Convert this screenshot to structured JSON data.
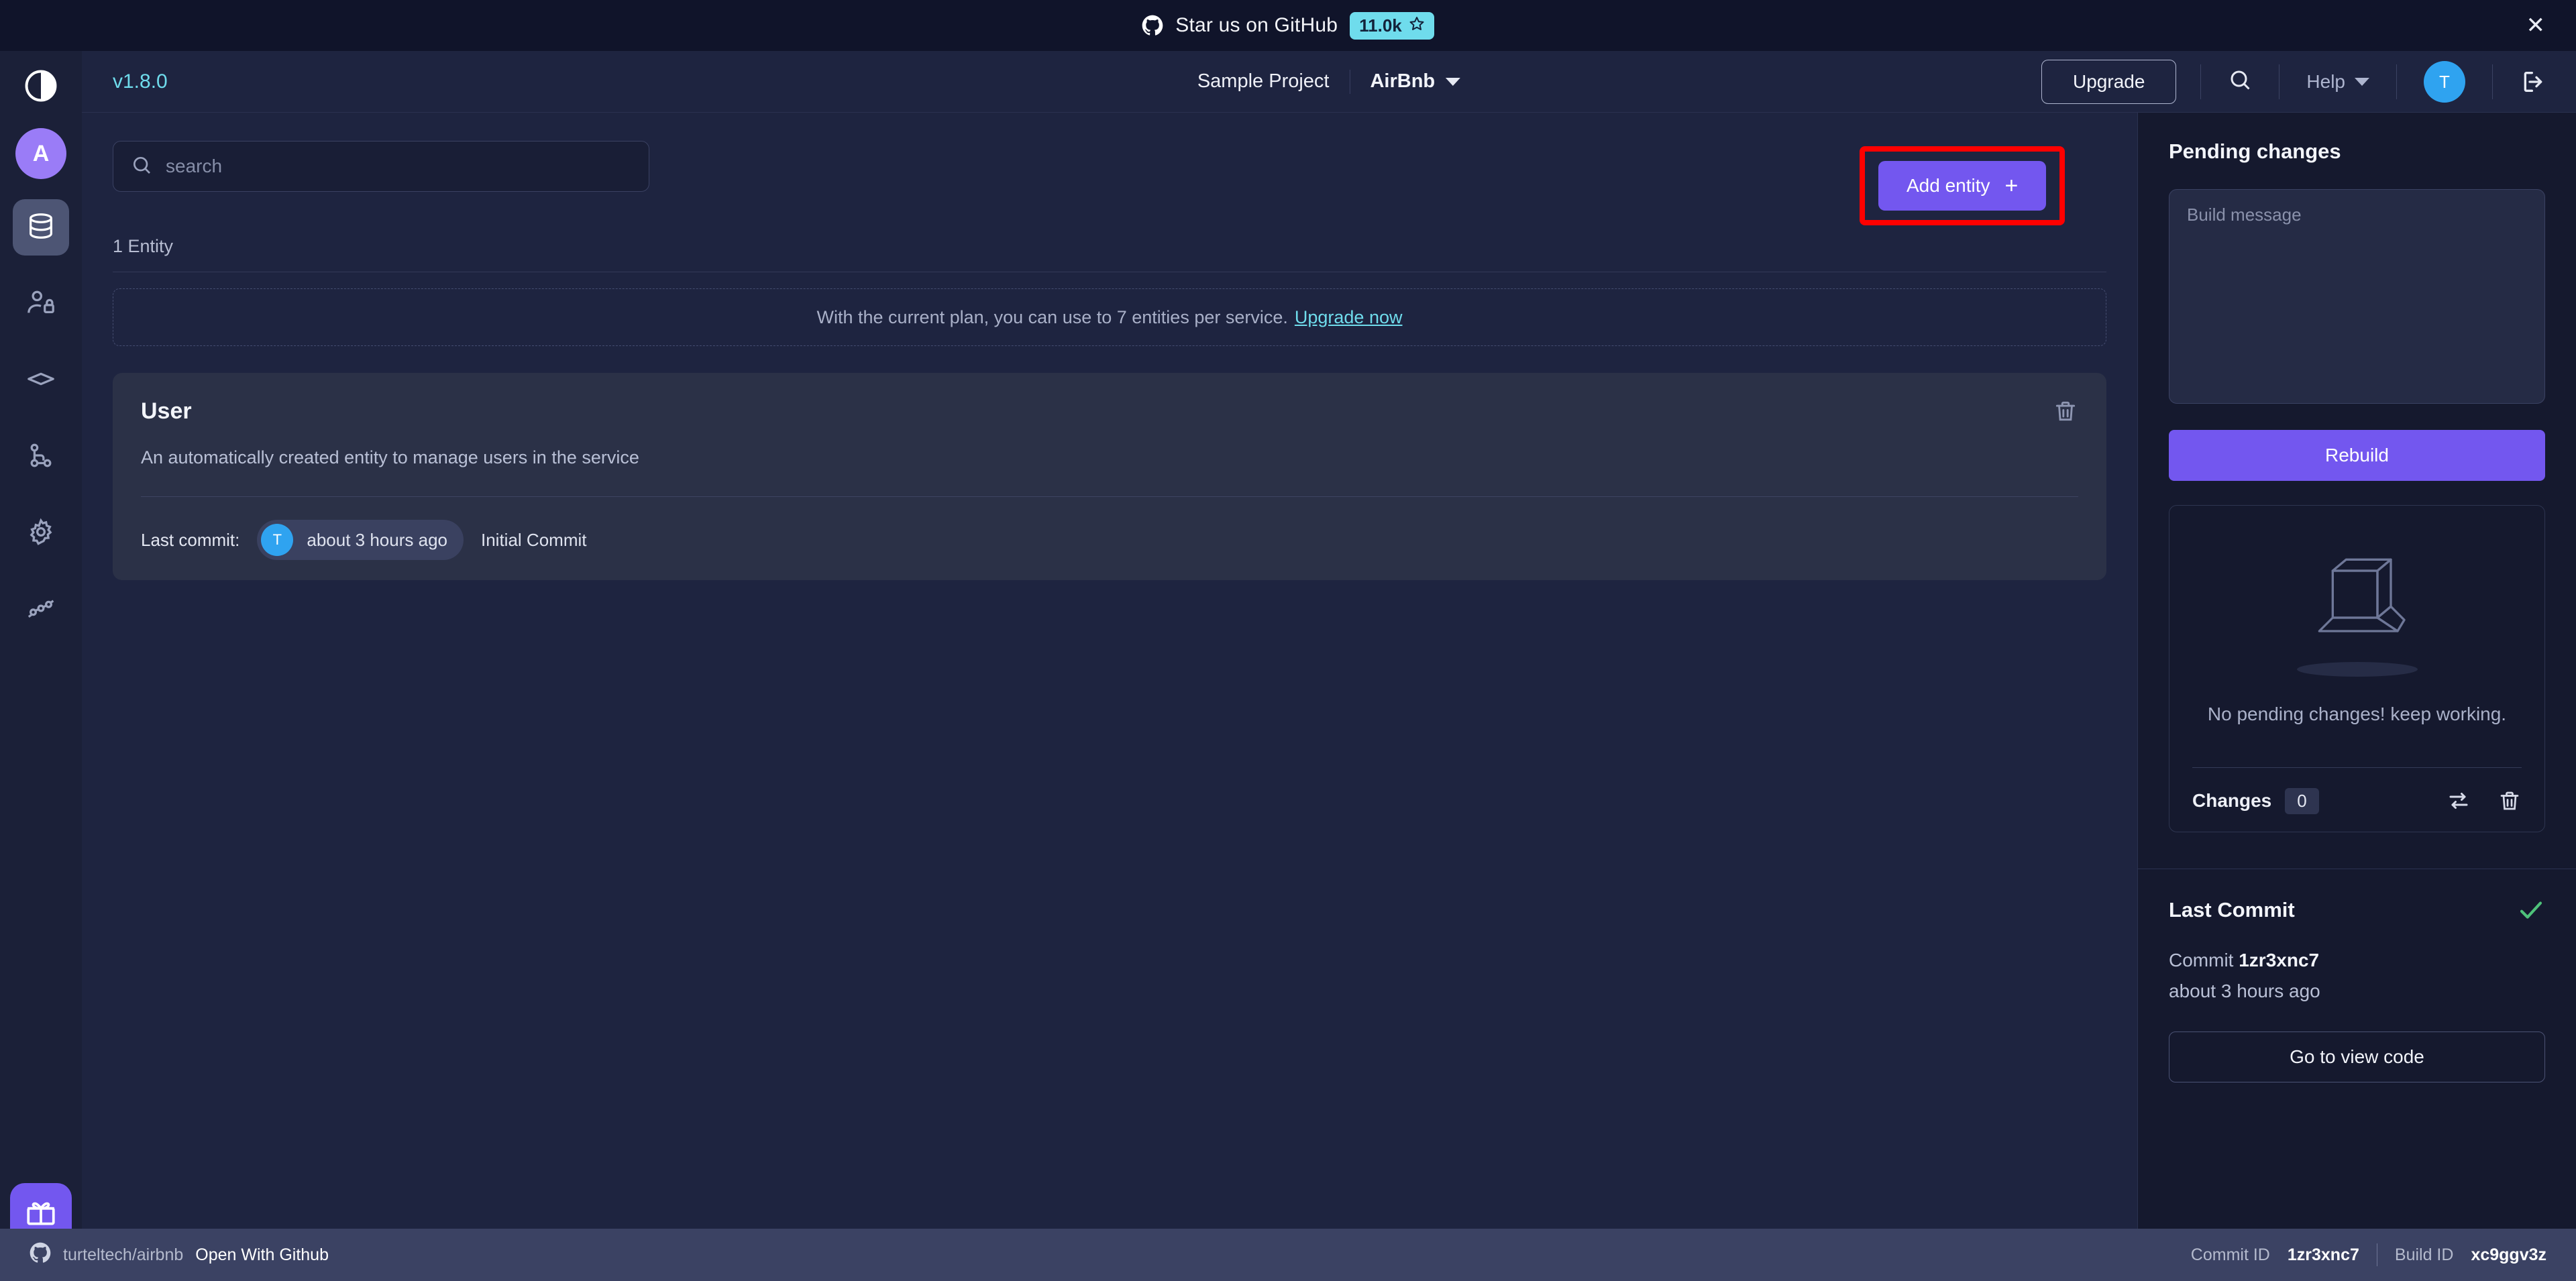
{
  "promo": {
    "icon": "github-icon",
    "text": "Star us on GitHub",
    "stars": "11.0k",
    "star_icon": "star-icon",
    "close_icon": "close-icon",
    "badge_color": "#6fdcec"
  },
  "rail": {
    "logo_icon": "app-logo-icon",
    "avatar_initial": "A",
    "avatar_color": "#9a7cf7",
    "items": [
      {
        "name": "entities",
        "icon": "database-icon",
        "active": true
      },
      {
        "name": "roles",
        "icon": "user-lock-icon",
        "active": false
      },
      {
        "name": "plugins",
        "icon": "diamond-icon",
        "active": false
      },
      {
        "name": "commits",
        "icon": "git-branch-icon",
        "active": false
      },
      {
        "name": "settings",
        "icon": "gear-icon",
        "active": false
      },
      {
        "name": "connections",
        "icon": "api-link-icon",
        "active": false
      }
    ],
    "gift_icon": "gift-icon",
    "gift_color": "#7357ef"
  },
  "header": {
    "version": "v1.8.0",
    "project_name": "Sample Project",
    "service_name": "AirBnb",
    "service_chevron_icon": "chevron-down-icon",
    "upgrade_label": "Upgrade",
    "search_icon": "search-icon",
    "help_label": "Help",
    "help_chevron_icon": "chevron-down-icon",
    "avatar_initial": "T",
    "avatar_color": "#2fa3f0",
    "logout_icon": "logout-icon"
  },
  "main": {
    "search_placeholder": "search",
    "search_value": "",
    "search_icon": "search-icon",
    "entity_count_label": "1 Entity",
    "plan_banner": {
      "text": "With the current plan, you can use to 7 entities per service.",
      "link_label": "Upgrade now",
      "link_color": "#6fdcec"
    },
    "add_entity_label": "Add entity",
    "add_entity_plus": "+",
    "add_entity_color": "#7357ef",
    "highlight_color": "#ff0000",
    "entities": [
      {
        "title": "User",
        "description": "An automatically created entity to manage users in the service",
        "last_commit_label": "Last commit:",
        "commit_author_initial": "T",
        "commit_time": "about 3 hours ago",
        "commit_message": "Initial Commit",
        "delete_icon": "trash-icon"
      }
    ]
  },
  "pending_panel": {
    "title": "Pending changes",
    "build_message_placeholder": "Build message",
    "build_message_value": "",
    "rebuild_label": "Rebuild",
    "empty_icon": "open-box-icon",
    "empty_text": "No pending changes! keep working.",
    "changes_label": "Changes",
    "changes_count": "0",
    "compare_icon": "compare-arrows-icon",
    "discard_icon": "trash-icon"
  },
  "last_commit_panel": {
    "title": "Last Commit",
    "status_icon": "check-icon",
    "status_color": "#4ec27a",
    "commit_label": "Commit",
    "commit_id": "1zr3xnc7",
    "commit_ago": "about 3 hours ago",
    "view_code_label": "Go to view code"
  },
  "statusbar": {
    "github_icon": "github-icon",
    "repo": "turteltech/airbnb",
    "open_with_github": "Open With Github",
    "commit_id_label": "Commit ID",
    "commit_id": "1zr3xnc7",
    "build_id_label": "Build ID",
    "build_id": "xc9ggv3z"
  }
}
